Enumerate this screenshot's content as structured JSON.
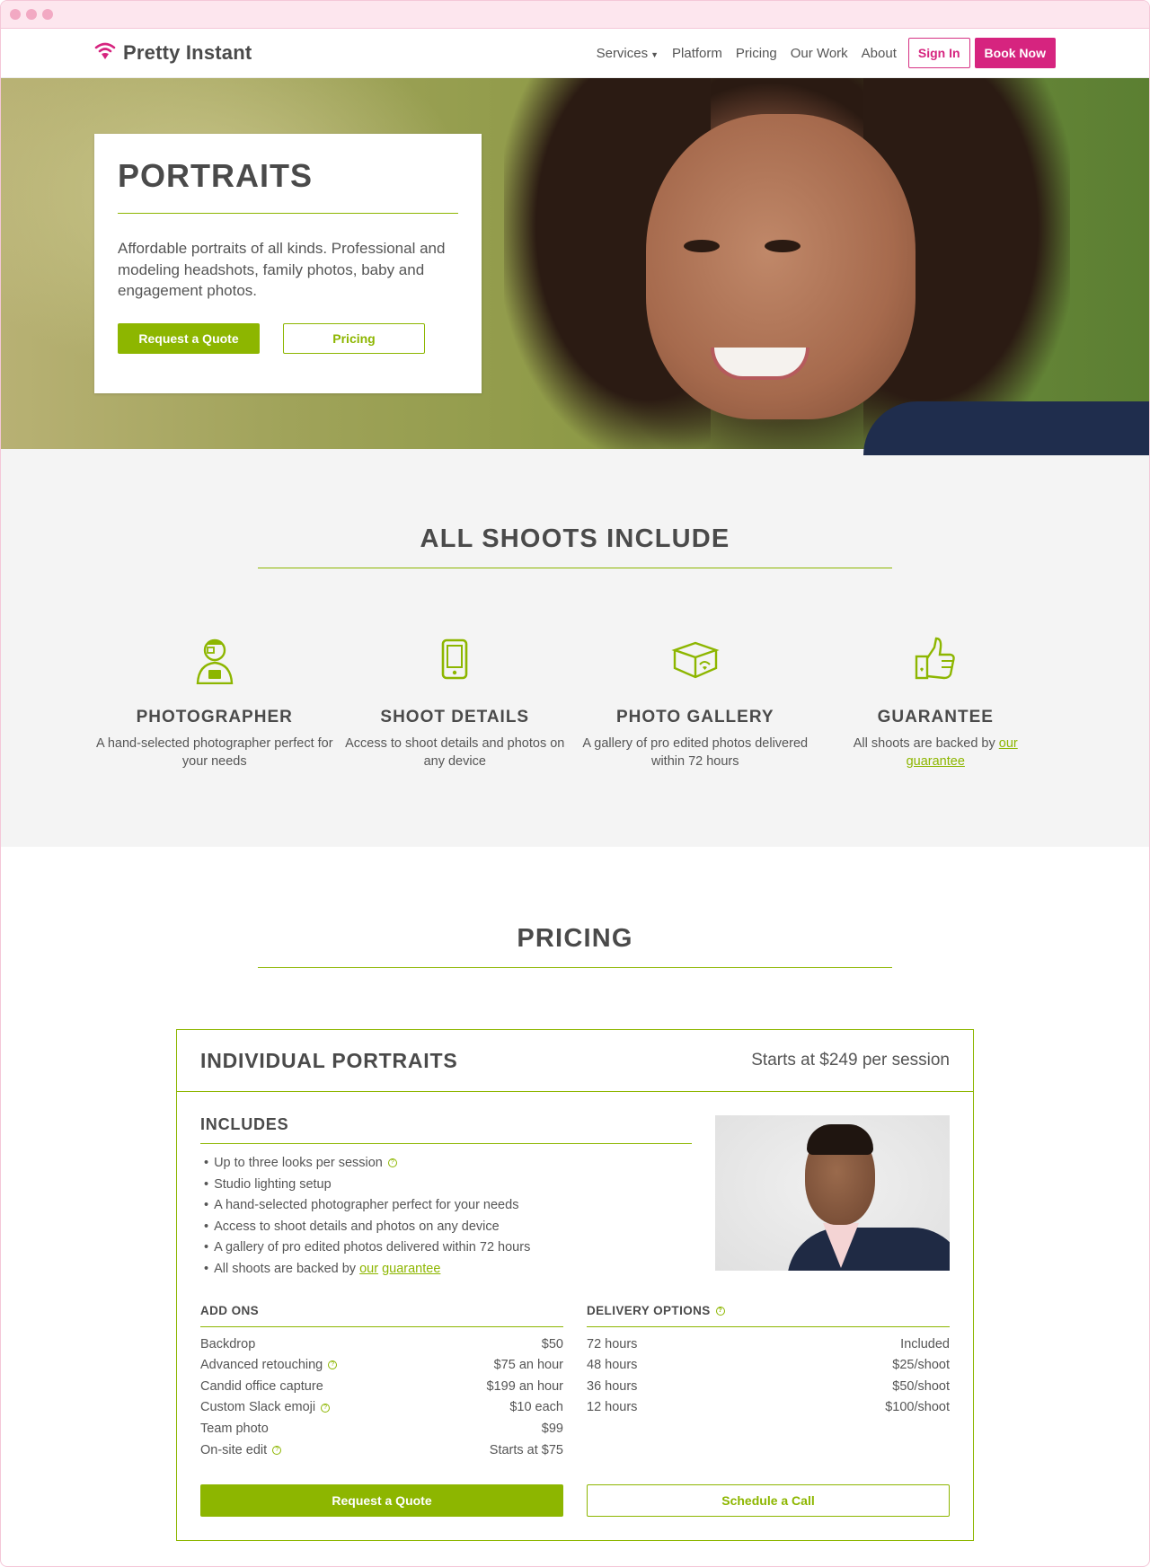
{
  "brand": {
    "name": "Pretty Instant",
    "accent": "#d6247f",
    "green": "#8db600"
  },
  "nav": {
    "items": [
      "Services",
      "Platform",
      "Pricing",
      "Our Work",
      "About"
    ],
    "sign_in": "Sign In",
    "book_now": "Book Now"
  },
  "hero": {
    "title": "PORTRAITS",
    "description": "Affordable portraits of all kinds. Professional and modeling headshots, family photos, baby and engagement photos.",
    "primary_btn": "Request a Quote",
    "secondary_btn": "Pricing"
  },
  "includes": {
    "title": "ALL SHOOTS INCLUDE",
    "features": [
      {
        "icon": "photographer-icon",
        "title": "PHOTOGRAPHER",
        "desc": "A hand-selected photographer perfect for your needs"
      },
      {
        "icon": "phone-icon",
        "title": "SHOOT DETAILS",
        "desc": "Access to shoot details and photos on any device"
      },
      {
        "icon": "gallery-box-icon",
        "title": "PHOTO GALLERY",
        "desc": "A gallery of pro edited photos delivered within 72 hours"
      },
      {
        "icon": "thumbs-up-icon",
        "title": "GUARANTEE",
        "desc_prefix": "All shoots are backed by",
        "link1": "our",
        "link2": "guarantee"
      }
    ]
  },
  "pricing": {
    "title": "PRICING",
    "card": {
      "title": "INDIVIDUAL PORTRAITS",
      "price": "Starts at $249 per session",
      "includes_title": "INCLUDES",
      "includes": [
        "Up to three looks per session",
        "Studio lighting setup",
        "A hand-selected photographer perfect for your needs",
        "Access to shoot details and photos on any device",
        "A gallery of pro edited photos delivered within 72 hours",
        "All shoots are backed by"
      ],
      "guarantee_link1": "our",
      "guarantee_link2": "guarantee",
      "addons_title": "ADD ONS",
      "addons": [
        {
          "name": "Backdrop",
          "price": "$50"
        },
        {
          "name": "Advanced retouching",
          "price": "$75 an hour"
        },
        {
          "name": "Candid office capture",
          "price": "$199 an hour"
        },
        {
          "name": "Custom Slack emoji",
          "price": "$10 each"
        },
        {
          "name": "Team photo",
          "price": "$99"
        },
        {
          "name": "On-site edit",
          "price": "Starts at $75"
        }
      ],
      "delivery_title": "DELIVERY OPTIONS",
      "delivery": [
        {
          "name": "72 hours",
          "price": "Included"
        },
        {
          "name": "48 hours",
          "price": "$25/shoot"
        },
        {
          "name": "36 hours",
          "price": "$50/shoot"
        },
        {
          "name": "12 hours",
          "price": "$100/shoot"
        }
      ],
      "quote_btn": "Request a Quote",
      "call_btn": "Schedule a Call"
    }
  }
}
